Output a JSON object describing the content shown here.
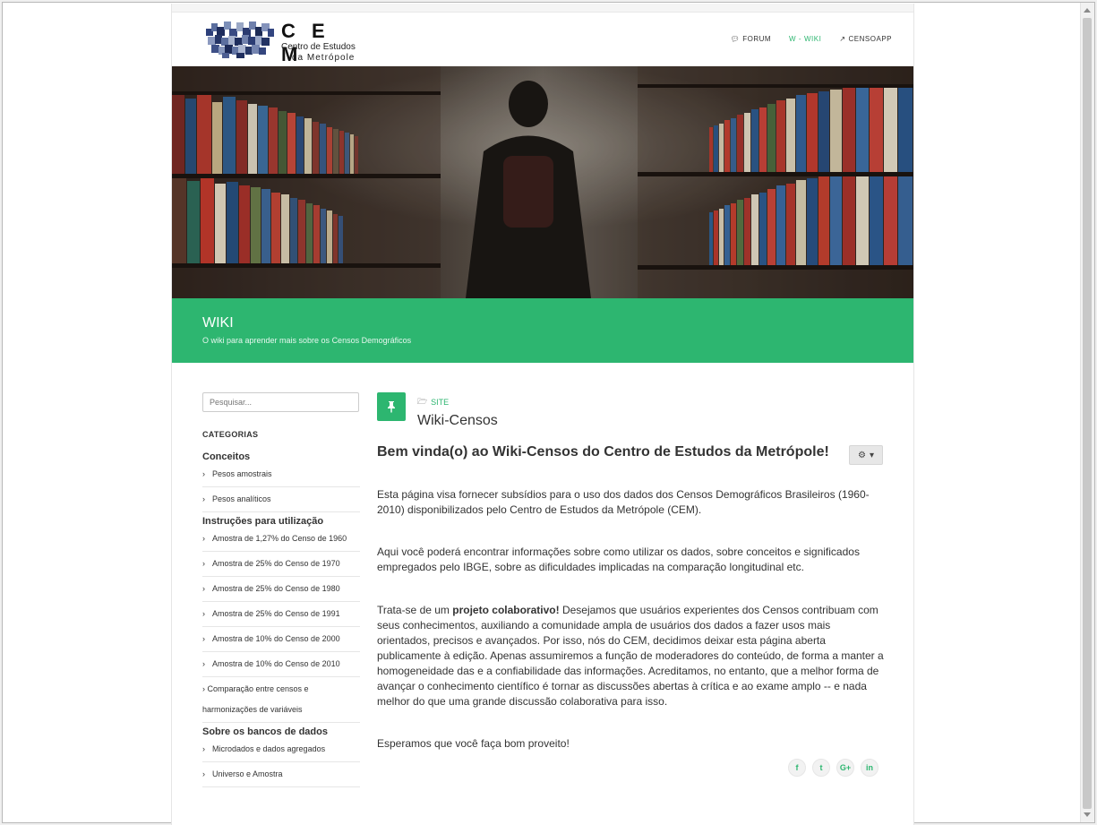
{
  "header": {
    "logo": {
      "name": "C E M",
      "line1": "Centro de Estudos",
      "line2": "da  Metrópole"
    },
    "nav": [
      {
        "label": "FORUM",
        "icon": "comment-icon"
      },
      {
        "label": "WIKI",
        "prefix": "W -",
        "icon": "wikipedia-icon",
        "active": true
      },
      {
        "label": "CENSOAPP",
        "icon": "external-link-icon"
      }
    ]
  },
  "banner": {
    "title": "WIKI",
    "subtitle": "O wiki para aprender mais sobre os Censos Demográficos"
  },
  "sidebar": {
    "search_placeholder": "Pesquisar...",
    "categories_heading": "CATEGORIAS",
    "groups": [
      {
        "title": "Conceitos",
        "items": [
          "Pesos amostrais",
          "Pesos analíticos"
        ]
      },
      {
        "title": "Instruções para utilização",
        "items": [
          "Amostra de 1,27% do Censo de 1960",
          "Amostra de 25% do Censo de 1970",
          "Amostra de 25% do Censo de 1980",
          "Amostra de 25% do Censo de 1991",
          "Amostra de 10% do Censo de 2000",
          "Amostra de 10% do Censo de 2010",
          "Comparação entre censos e harmonizações de variáveis"
        ]
      },
      {
        "title": "Sobre os bancos de dados",
        "items": [
          "Microdados e dados agregados",
          "Universo e Amostra"
        ]
      }
    ]
  },
  "content": {
    "breadcrumb": "SITE",
    "page_title": "Wiki-Censos",
    "headline": "Bem vinda(o) ao Wiki-Censos do Centro de Estudos da Metrópole!",
    "paragraphs": {
      "p1": "Esta página visa fornecer subsídios para o uso dos dados dos Censos Demográficos Brasileiros (1960-2010) disponibilizados pelo Centro de Estudos da Metrópole (CEM).",
      "p2": "Aqui você poderá encontrar informações sobre como utilizar os dados, sobre conceitos e significados empregados pelo IBGE, sobre as dificuldades implicadas na comparação longitudinal etc.",
      "p3_lead": "Trata-se de um ",
      "p3_bold": "projeto colaborativo!",
      "p3_rest": " Desejamos que usuários experientes dos Censos contribuam com seus conhecimentos, auxiliando a comunidade ampla de usuários dos dados a fazer usos mais orientados, precisos e avançados. Por isso, nós do CEM, decidimos deixar esta página aberta publicamente à edição. Apenas assumiremos a função de moderadores do conteúdo, de forma a manter a homogeneidade das e a confiabilidade das informações. Acreditamos, no entanto, que a melhor forma de avançar o conhecimento científico é tornar as discussões abertas à crítica e ao exame amplo -- e nada melhor do que uma grande discussão colaborativa para isso.",
      "p4": "Esperamos que você faça bom proveito!"
    },
    "share": [
      {
        "icon": "facebook-icon",
        "glyph": "f"
      },
      {
        "icon": "twitter-icon",
        "glyph": "t"
      },
      {
        "icon": "google-plus-icon",
        "glyph": "G+"
      },
      {
        "icon": "linkedin-icon",
        "glyph": "in"
      }
    ]
  },
  "colors": {
    "accent": "#2db670"
  }
}
